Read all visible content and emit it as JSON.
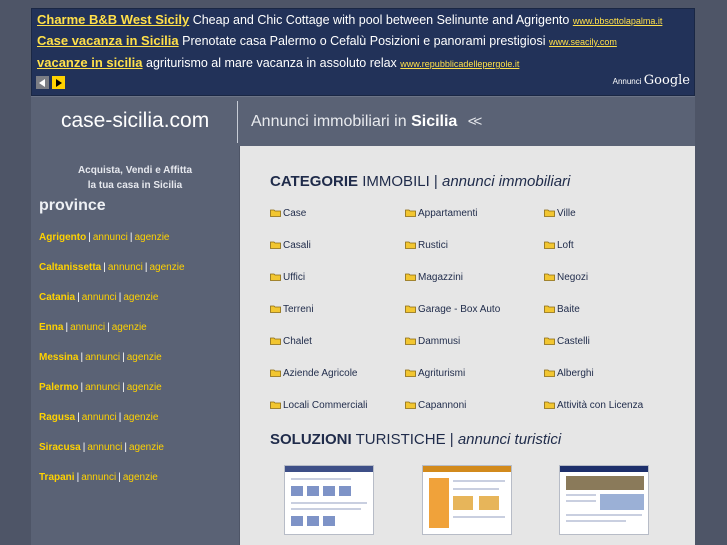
{
  "ads": {
    "lines": [
      {
        "title": "Charme B&B West Sicily",
        "text": "Cheap and Chic Cottage with pool between Selinunte and Agrigento",
        "url": "www.bbsottolapalma.it"
      },
      {
        "title": "Case vacanza in Sicilia",
        "text": "Prenotate casa Palermo o Cefalù Posizioni e panorami prestigiosi",
        "url": "www.seacily.com"
      },
      {
        "title": "vacanze in sicilia",
        "text": "agriturismo al mare vacanza in assoluto relax",
        "url": "www.repubblicadellepergole.it"
      }
    ],
    "annunci_label": "Annunci",
    "google_label": "Google"
  },
  "header": {
    "logo": "case-sicilia.com",
    "tagline_prefix": "Annunci immobiliari in",
    "tagline_bold": "Sicilia",
    "tagline_arrows": "<<"
  },
  "sidebar": {
    "intro_line1": "Acquista, Vendi e Affitta",
    "intro_line2": "la tua casa in Sicilia",
    "province_title": "province",
    "provinces": [
      {
        "name": "Agrigento",
        "annunci": "annunci",
        "agenzie": "agenzie"
      },
      {
        "name": "Caltanissetta",
        "annunci": "annunci",
        "agenzie": "agenzie"
      },
      {
        "name": "Catania",
        "annunci": "annunci",
        "agenzie": "agenzie"
      },
      {
        "name": "Enna",
        "annunci": "annunci",
        "agenzie": "agenzie"
      },
      {
        "name": "Messina",
        "annunci": "annunci",
        "agenzie": "agenzie"
      },
      {
        "name": "Palermo",
        "annunci": "annunci",
        "agenzie": "agenzie"
      },
      {
        "name": "Ragusa",
        "annunci": "annunci",
        "agenzie": "agenzie"
      },
      {
        "name": "Siracusa",
        "annunci": "annunci",
        "agenzie": "agenzie"
      },
      {
        "name": "Trapani",
        "annunci": "annunci",
        "agenzie": "agenzie"
      }
    ]
  },
  "main": {
    "categorie": {
      "bold": "CATEGORIE",
      "normal": "IMMOBILI |",
      "italic": "annunci immobiliari"
    },
    "categories": [
      [
        "Case",
        "Appartamenti",
        "Ville"
      ],
      [
        "Casali",
        "Rustici",
        "Loft"
      ],
      [
        "Uffici",
        "Magazzini",
        "Negozi"
      ],
      [
        "Terreni",
        "Garage - Box Auto",
        "Baite"
      ],
      [
        "Chalet",
        "Dammusi",
        "Castelli"
      ],
      [
        "Aziende Agricole",
        "Agriturismi",
        "Alberghi"
      ],
      [
        "Locali Commerciali",
        "Capannoni",
        "Attività con Licenza"
      ]
    ],
    "soluzioni": {
      "bold": "SOLUZIONI",
      "normal": "TURISTICHE |",
      "italic": "annunci turistici"
    }
  },
  "colors": {
    "accent": "#ffd200",
    "ad_background": "#223259",
    "main_text": "#1f2b4a",
    "folder": "#f2c631"
  }
}
